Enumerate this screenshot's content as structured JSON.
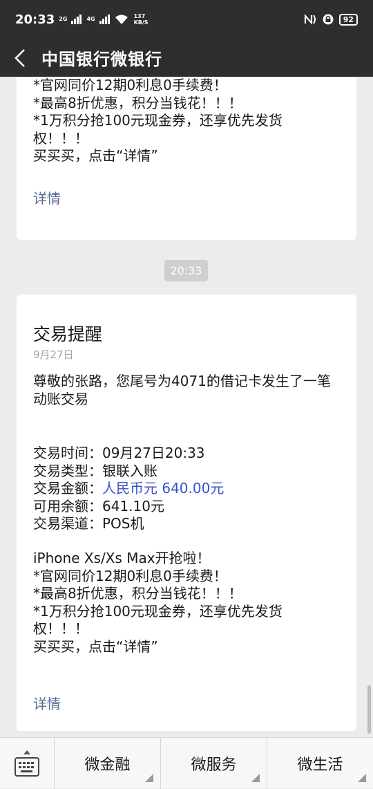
{
  "status_bar": {
    "time": "20:33",
    "sim1_label": "2G",
    "sim2_label": "4G",
    "speed_value": "137",
    "speed_unit": "KB/S",
    "battery": "92"
  },
  "nav": {
    "title": "中国银行微银行"
  },
  "message_top": {
    "lines": [
      "*官网同价12期0利息0手续费！",
      "*最高8折优惠，积分当钱花！！！",
      "*1万积分抢100元现金券，还享优先发货",
      "权！！！",
      "买买买，点击“详情”"
    ],
    "detail_label": "详情"
  },
  "timestamp": "20:33",
  "message_main": {
    "title": "交易提醒",
    "date": "9月27日",
    "intro_lines": [
      "尊敬的张路，您尾号为4071的借记卡发生了一笔",
      "动账交易"
    ],
    "fields": [
      {
        "label": "交易时间：",
        "value": "09月27日20:33"
      },
      {
        "label": "交易类型：",
        "value": "银联入账"
      },
      {
        "label": "交易金额：",
        "value": "人民币元 640.00元"
      },
      {
        "label": "可用余额：",
        "value": "641.10元"
      },
      {
        "label": "交易渠道：",
        "value": "POS机"
      }
    ],
    "promo_lines": [
      "iPhone Xs/Xs Max开抢啦！",
      "*官网同价12期0利息0手续费！",
      "*最高8折优惠，积分当钱花！！！",
      "*1万积分抢100元现金券，还享优先发货",
      "权！！！",
      "买买买，点击“详情”"
    ],
    "detail_label": "详情",
    "amount_color": "#3b4fc9"
  },
  "bottom_menu": {
    "keyboard_icon": "keyboard-icon",
    "items": [
      {
        "label": "微金融"
      },
      {
        "label": "微服务"
      },
      {
        "label": "微生活"
      }
    ]
  }
}
